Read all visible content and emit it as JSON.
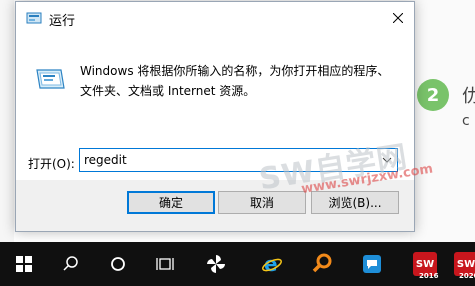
{
  "dialog": {
    "title": "运行",
    "description": "Windows 将根据你所输入的名称，为你打开相应的程序、文件夹、文档或 Internet 资源。",
    "open_label": "打开(O):",
    "open_value": "regedit",
    "buttons": {
      "ok": "确定",
      "cancel": "取消",
      "browse": "浏览(B)..."
    }
  },
  "background": {
    "step_number": "2",
    "partial_char_1": "仂",
    "partial_char_2": "c",
    "watermark_text": "SW自学网",
    "watermark_url": "www.swrjzxw.com"
  },
  "taskbar": {
    "items": [
      {
        "name": "start",
        "icon": "windows-logo-icon"
      },
      {
        "name": "search",
        "icon": "search-icon"
      },
      {
        "name": "cortana",
        "icon": "circle-icon"
      },
      {
        "name": "task-view",
        "icon": "task-view-icon"
      },
      {
        "name": "app-fan",
        "icon": "pinwheel-icon"
      },
      {
        "name": "ie",
        "icon": "internet-explorer-icon"
      },
      {
        "name": "search-app",
        "icon": "magnifier-orange-icon"
      },
      {
        "name": "chat",
        "icon": "chat-bubble-icon"
      },
      {
        "name": "sw2016",
        "label": "SW",
        "year": "2016"
      },
      {
        "name": "sw2020",
        "label": "SW",
        "year": "2020"
      }
    ]
  },
  "colors": {
    "accent": "#0078d7",
    "taskbar": "#101010",
    "step_green": "#79c36a",
    "sw_red": "#c8161d"
  }
}
